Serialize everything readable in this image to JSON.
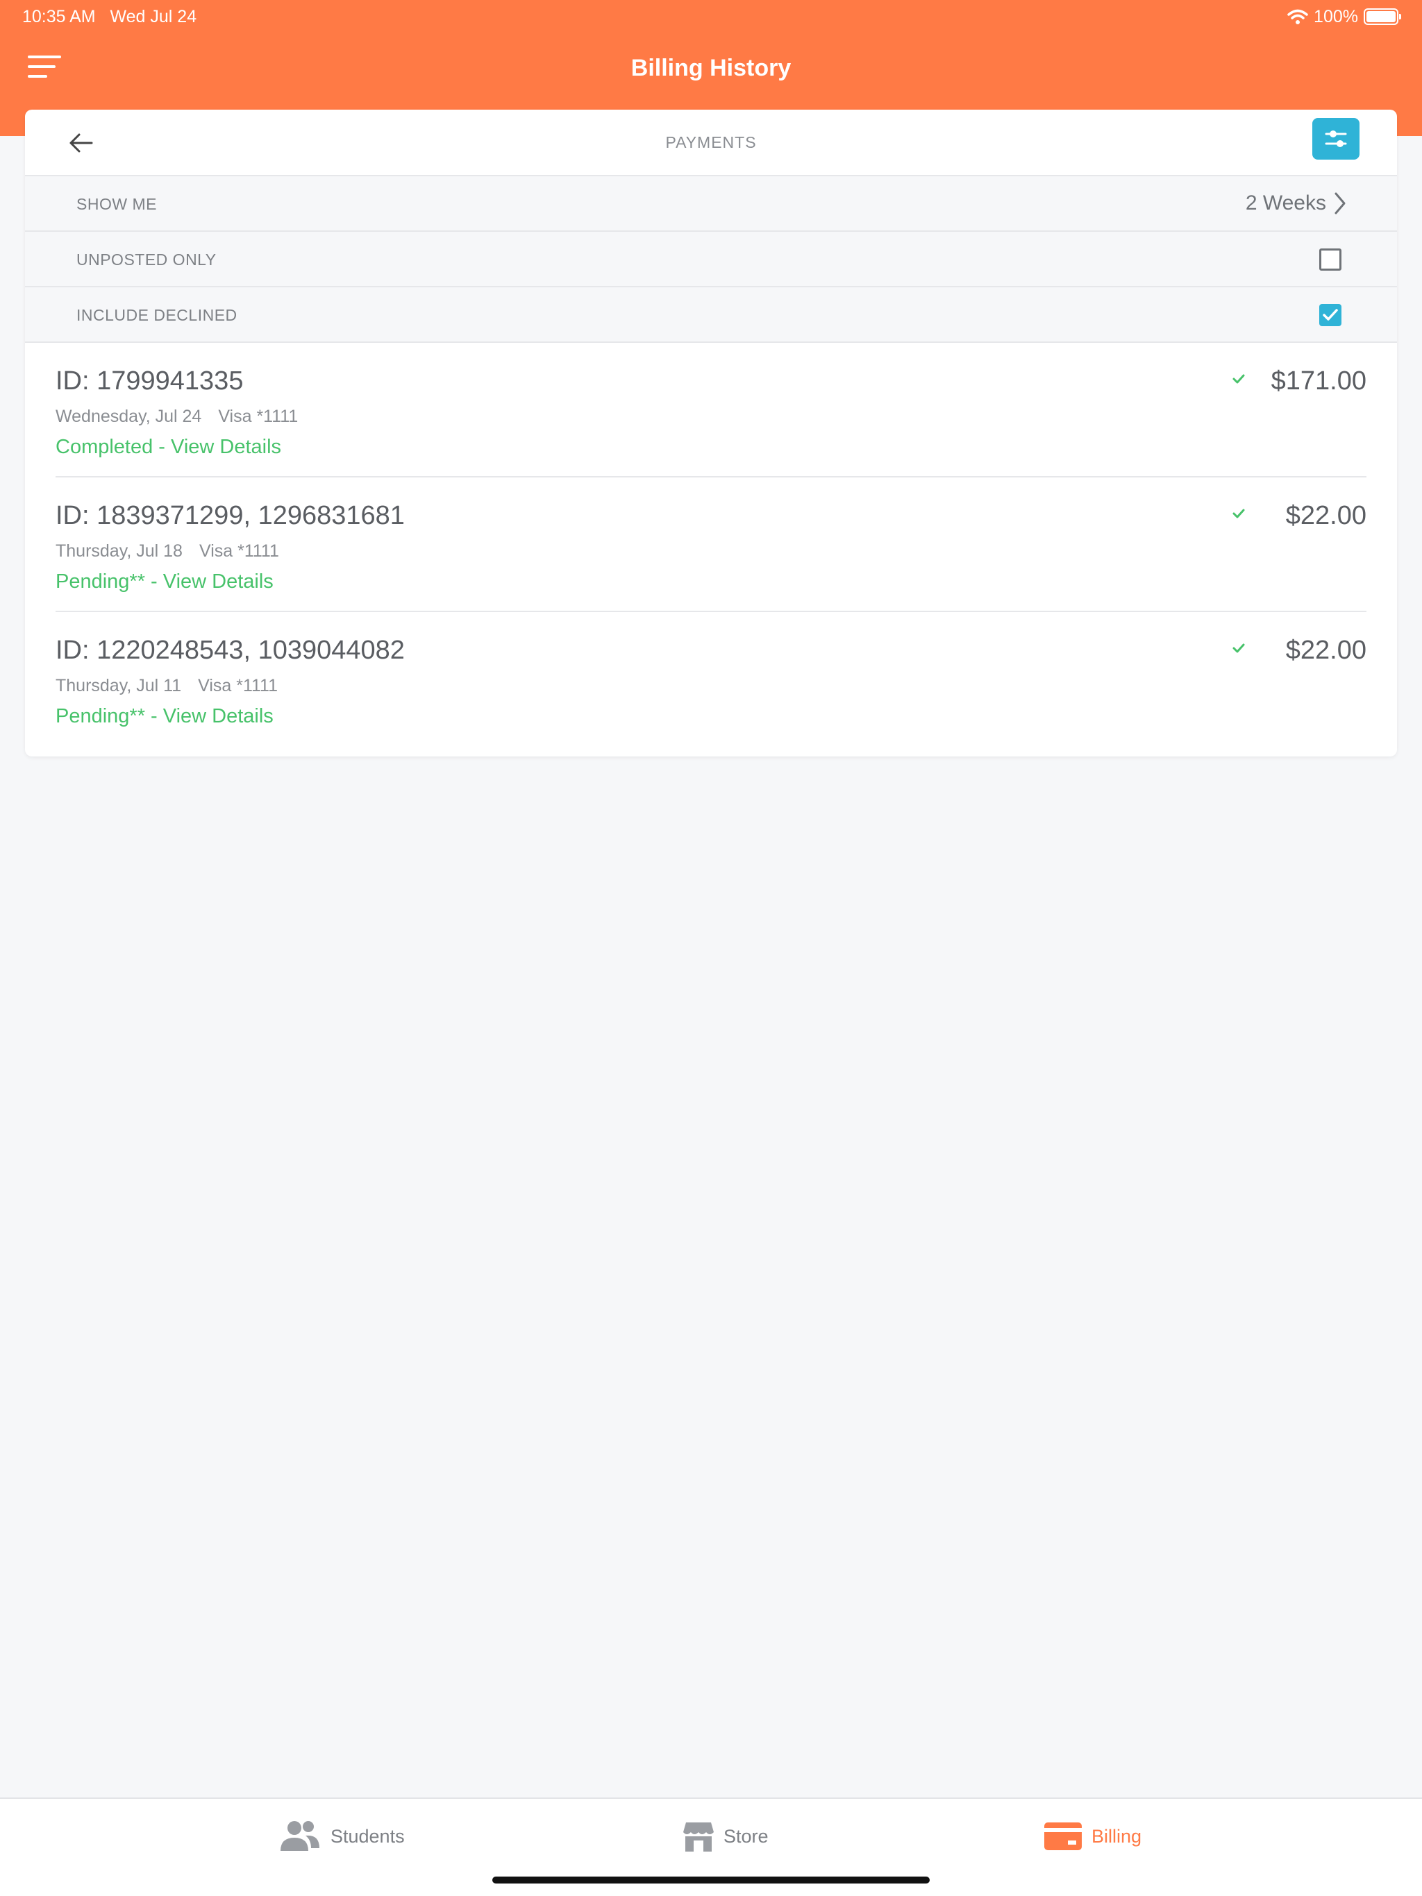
{
  "status_bar": {
    "time": "10:35 AM",
    "date": "Wed Jul 24",
    "battery": "100%"
  },
  "header": {
    "title": "Billing History"
  },
  "card": {
    "title": "PAYMENTS"
  },
  "options": {
    "show_me": {
      "label": "SHOW ME",
      "value": "2 Weeks"
    },
    "unposted_only": {
      "label": "UNPOSTED ONLY",
      "checked": false
    },
    "include_declined": {
      "label": "INCLUDE DECLINED",
      "checked": true
    }
  },
  "payments": [
    {
      "id": "ID: 1799941335",
      "date": "Wednesday, Jul 24",
      "card": "Visa *1111",
      "status": "Completed - View Details",
      "amount": "$171.00"
    },
    {
      "id": "ID: 1839371299, 1296831681",
      "date": "Thursday, Jul 18",
      "card": "Visa *1111",
      "status": "Pending** - View Details",
      "amount": "$22.00"
    },
    {
      "id": "ID: 1220248543, 1039044082",
      "date": "Thursday, Jul 11",
      "card": "Visa *1111",
      "status": "Pending** - View Details",
      "amount": "$22.00"
    }
  ],
  "tabs": [
    {
      "label": "Students",
      "icon": "students-icon"
    },
    {
      "label": "Store",
      "icon": "store-icon"
    },
    {
      "label": "Billing",
      "icon": "billing-card-icon",
      "active": true
    }
  ],
  "colors": {
    "brand": "#ff7a45",
    "accent": "#2fb3d7",
    "success": "#47c26a"
  }
}
